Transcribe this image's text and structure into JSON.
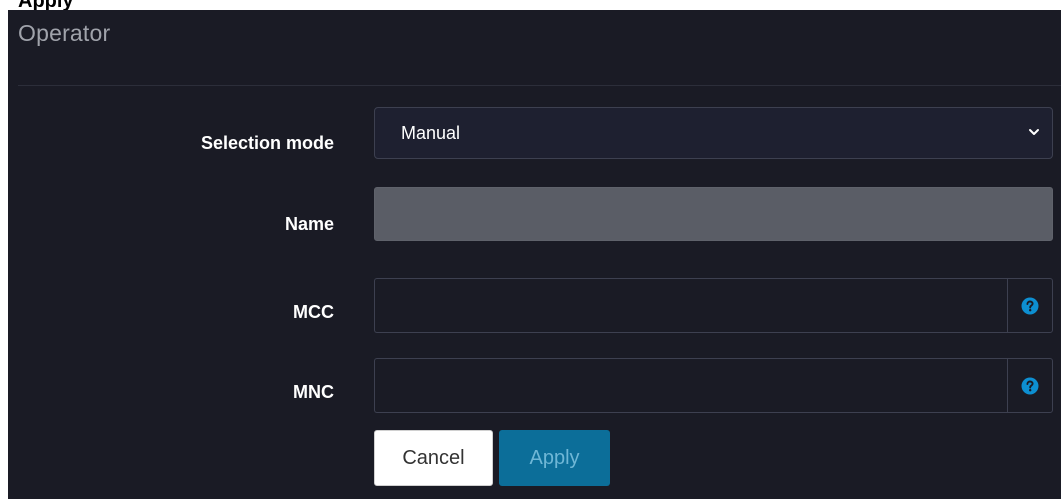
{
  "header_fragment": "Apply",
  "panel": {
    "title": "Operator"
  },
  "form": {
    "selection_mode": {
      "label": "Selection mode",
      "value": "Manual"
    },
    "name": {
      "label": "Name",
      "value": ""
    },
    "mcc": {
      "label": "MCC",
      "value": "",
      "help_icon": "question-circle-icon"
    },
    "mnc": {
      "label": "MNC",
      "value": "",
      "help_icon": "question-circle-icon"
    }
  },
  "buttons": {
    "cancel": "Cancel",
    "apply": "Apply"
  },
  "colors": {
    "background": "#1a1b25",
    "accent": "#0c6e99",
    "help_icon": "#0d8fd1",
    "disabled_field": "#5a5d66"
  }
}
